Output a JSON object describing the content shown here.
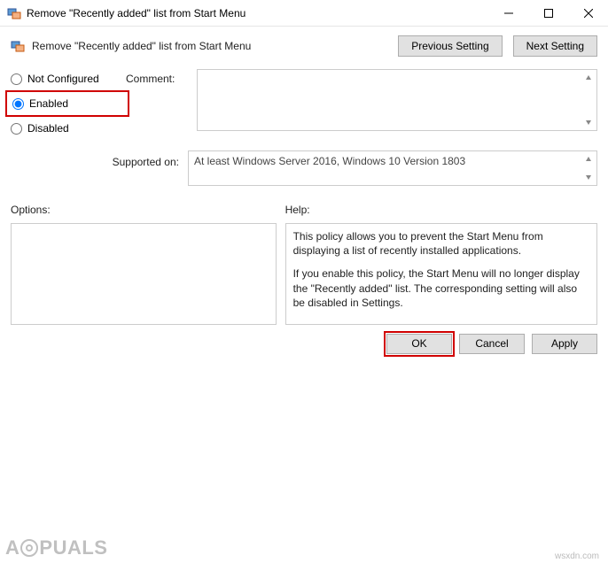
{
  "window": {
    "title": "Remove \"Recently added\" list from Start Menu",
    "subtitle": "Remove \"Recently added\" list from Start Menu"
  },
  "nav": {
    "previous": "Previous Setting",
    "next": "Next Setting"
  },
  "radios": {
    "not_configured": "Not Configured",
    "enabled": "Enabled",
    "disabled": "Disabled",
    "selected": "enabled"
  },
  "labels": {
    "comment": "Comment:",
    "supported_on": "Supported on:",
    "options": "Options:",
    "help": "Help:"
  },
  "supported_text": "At least Windows Server 2016, Windows 10 Version 1803",
  "help": {
    "p1": "This policy allows you to prevent the Start Menu from displaying a list of recently installed applications.",
    "p2": "If you enable this policy, the Start Menu will no longer display the \"Recently added\" list.  The corresponding setting will also be disabled in Settings."
  },
  "buttons": {
    "ok": "OK",
    "cancel": "Cancel",
    "apply": "Apply"
  },
  "watermark": {
    "prefix": "A",
    "suffix": "PUALS",
    "attribution": "wsxdn.com"
  }
}
